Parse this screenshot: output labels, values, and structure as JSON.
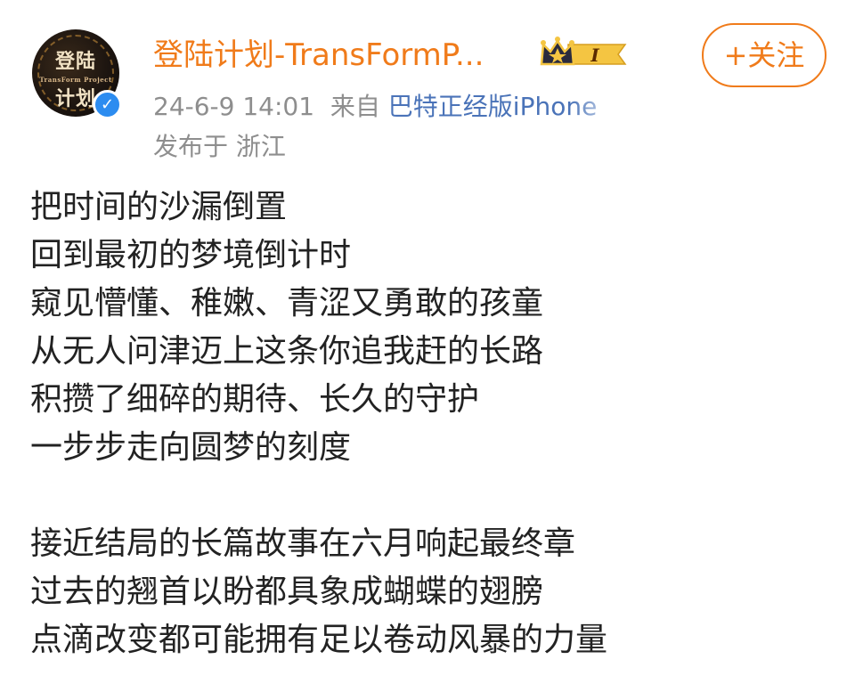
{
  "post": {
    "author": {
      "name": "登陆计划-TransFormP...",
      "avatar_text_top": "登陆",
      "avatar_text_mid": "TransForm Project",
      "avatar_text_bottom": "计划",
      "verified_icon": "check-icon",
      "vip_badge_level": "I"
    },
    "meta": {
      "datetime": "24-6-9 14:01",
      "source_prefix": "来自",
      "source_name": "巴特正经版iPhone",
      "location": "发布于 浙江"
    },
    "follow_label": "+关注",
    "paragraphs": [
      {
        "lines": [
          "把时间的沙漏倒置",
          "回到最初的梦境倒计时",
          "窥见懵懂、稚嫩、青涩又勇敢的孩童",
          "从无人问津迈上这条你追我赶的长路",
          "积攒了细碎的期待、长久的守护",
          "一步步走向圆梦的刻度"
        ]
      },
      {
        "lines": [
          "接近结局的长篇故事在六月响起最终章",
          "过去的翘首以盼都具象成蝴蝶的翅膀",
          "点滴改变都可能拥有足以卷动风暴的力量"
        ]
      }
    ]
  },
  "colors": {
    "accent": "#f07b1a",
    "link": "#4a73b8",
    "meta": "#8e8e8e",
    "text": "#222222",
    "verified": "#2c8cf0",
    "badge_gold": "#f4c542"
  }
}
